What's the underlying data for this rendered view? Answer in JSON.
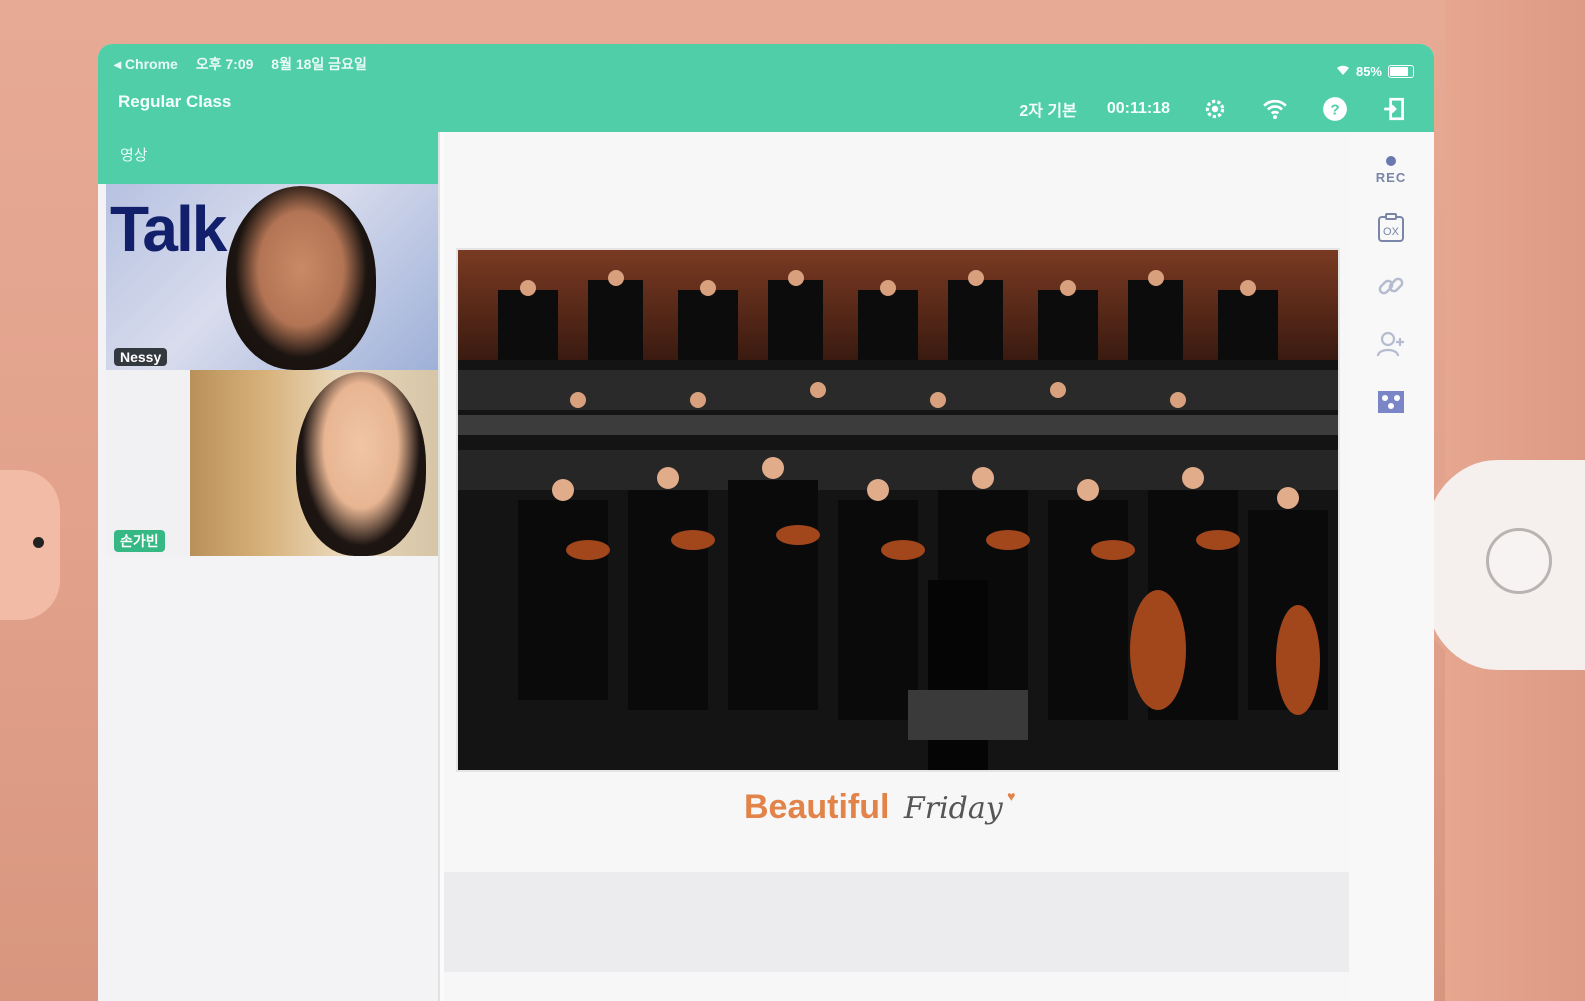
{
  "status_bar": {
    "back_app": "◂ Chrome",
    "time": "오후 7:09",
    "date": "8월 18일 금요일",
    "battery": "85%"
  },
  "header": {
    "title": "Regular Class",
    "mode": "2자 기본",
    "timer": "00:11:18",
    "icons": [
      "gear-icon",
      "wifi-icon",
      "help-icon",
      "exit-icon"
    ]
  },
  "video_panel": {
    "tab_label": "영상",
    "participants": [
      {
        "name": "Nessy",
        "banner_text": "Talk"
      },
      {
        "name": "손가빈"
      }
    ]
  },
  "whiteboard": {
    "caption_bold": "Beautiful",
    "caption_script": "Friday"
  },
  "tools": {
    "rec_label": "REC",
    "quiz_label": "OX",
    "items": [
      "rec-button",
      "ox-quiz-icon",
      "link-icon",
      "add-user-icon",
      "layout-icon"
    ]
  },
  "colors": {
    "brand_green": "#4fcea8",
    "caption_orange": "#e2834a",
    "case_pink": "#e2a28c"
  }
}
